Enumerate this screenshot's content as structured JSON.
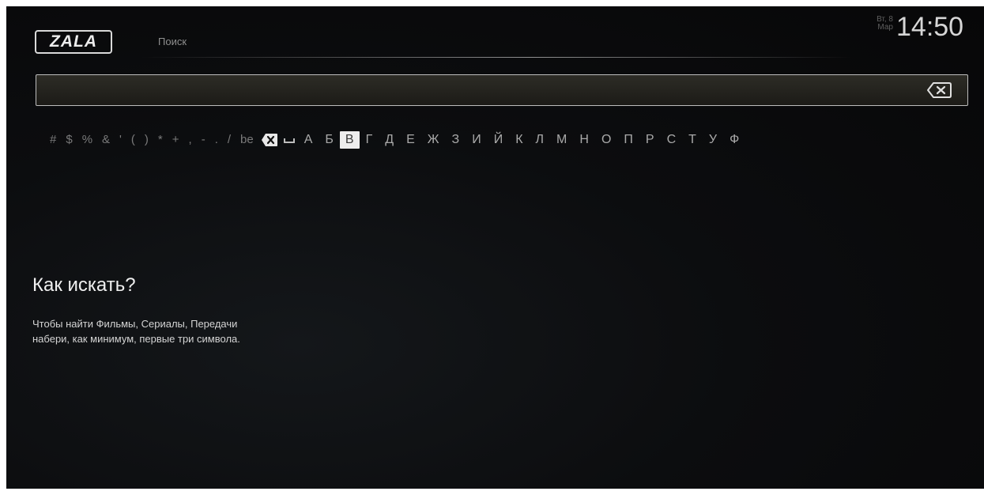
{
  "header": {
    "logo_text": "ZALA",
    "section_title": "Поиск",
    "date_line1": "Вт, 8",
    "date_line2": "Мар",
    "time": "14:50"
  },
  "search": {
    "value": "",
    "placeholder": ""
  },
  "keyboard": {
    "symbols": [
      "#",
      "$",
      "%",
      "&",
      "'",
      "(",
      ")",
      "*",
      "+",
      ",",
      "-",
      ".",
      "/"
    ],
    "mode_label": "be",
    "letters_before": [
      "А",
      "Б"
    ],
    "selected_letter": "В",
    "letters_after": [
      "Г",
      "Д",
      "Е",
      "Ж",
      "З",
      "И",
      "Й",
      "К",
      "Л",
      "М",
      "Н",
      "О",
      "П",
      "Р",
      "С",
      "Т",
      "У",
      "Ф"
    ]
  },
  "help": {
    "title": "Как искать?",
    "line1": "Чтобы найти Фильмы, Сериалы, Передачи",
    "line2": "набери, как минимум, первые три символа."
  },
  "colors": {
    "background": "#0b0c0e",
    "text": "#e6e6e6",
    "selected_key": "#ededed"
  }
}
